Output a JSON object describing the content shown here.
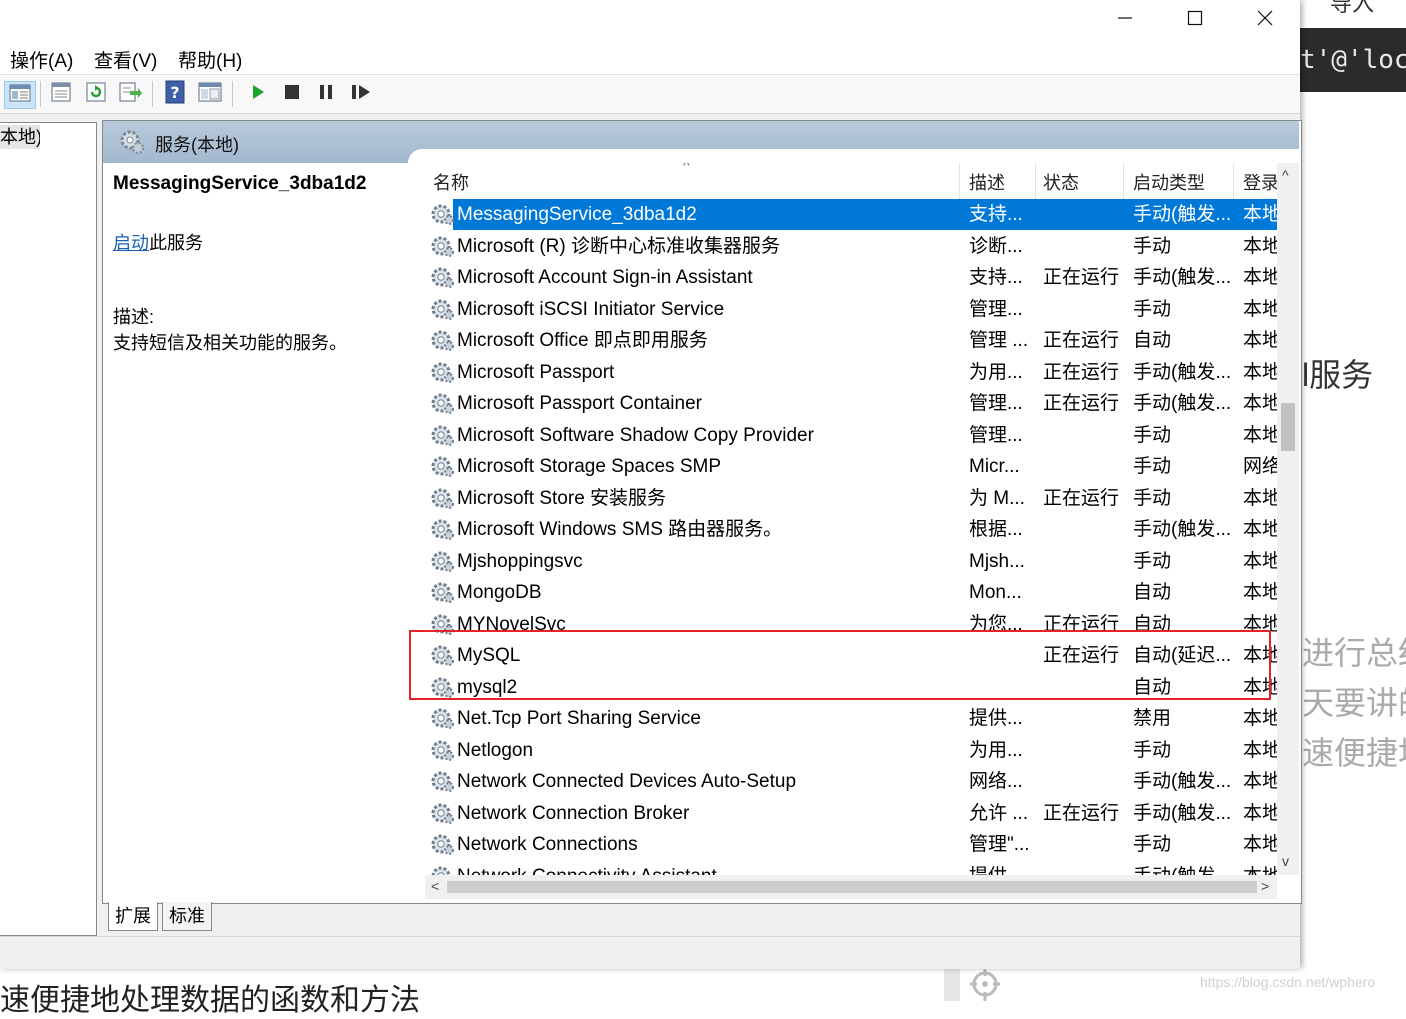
{
  "window": {
    "controls": {
      "minimize_icon": "minimize-icon",
      "maximize_icon": "maximize-icon",
      "close_icon": "close-icon"
    }
  },
  "menu": {
    "items": [
      "操作(A)",
      "查看(V)",
      "帮助(H)"
    ]
  },
  "toolbar": {
    "icons": [
      "show-hide-tree-icon",
      "properties-icon",
      "refresh-icon",
      "export-list-icon",
      "help-icon",
      "mmc-view-icon",
      "start-icon",
      "stop-icon",
      "pause-icon",
      "resume-icon"
    ]
  },
  "tree": {
    "selected_item": "本地)"
  },
  "pane_header": {
    "title": "服务(本地)"
  },
  "extended": {
    "service_name": "MessagingService_3dba1d2",
    "start_link": "启动",
    "start_suffix": "此服务",
    "desc_label": "描述:",
    "desc_text": "支持短信及相关功能的服务。"
  },
  "columns": {
    "name": "名称",
    "desc": "描述",
    "status": "状态",
    "startup": "启动类型",
    "logon": "登录"
  },
  "rows": [
    {
      "name": "MessagingService_3dba1d2",
      "desc": "支持...",
      "status": "",
      "startup": "手动(触发...",
      "logon": "本地"
    },
    {
      "name": "Microsoft (R) 诊断中心标准收集器服务",
      "desc": "诊断...",
      "status": "",
      "startup": "手动",
      "logon": "本地"
    },
    {
      "name": "Microsoft Account Sign-in Assistant",
      "desc": "支持...",
      "status": "正在运行",
      "startup": "手动(触发...",
      "logon": "本地"
    },
    {
      "name": "Microsoft iSCSI Initiator Service",
      "desc": "管理...",
      "status": "",
      "startup": "手动",
      "logon": "本地"
    },
    {
      "name": "Microsoft Office 即点即用服务",
      "desc": "管理 ...",
      "status": "正在运行",
      "startup": "自动",
      "logon": "本地"
    },
    {
      "name": "Microsoft Passport",
      "desc": "为用...",
      "status": "正在运行",
      "startup": "手动(触发...",
      "logon": "本地"
    },
    {
      "name": "Microsoft Passport Container",
      "desc": "管理...",
      "status": "正在运行",
      "startup": "手动(触发...",
      "logon": "本地"
    },
    {
      "name": "Microsoft Software Shadow Copy Provider",
      "desc": "管理...",
      "status": "",
      "startup": "手动",
      "logon": "本地"
    },
    {
      "name": "Microsoft Storage Spaces SMP",
      "desc": "Micr...",
      "status": "",
      "startup": "手动",
      "logon": "网络"
    },
    {
      "name": "Microsoft Store 安装服务",
      "desc": "为 M...",
      "status": "正在运行",
      "startup": "手动",
      "logon": "本地"
    },
    {
      "name": "Microsoft Windows SMS 路由器服务。",
      "desc": "根据...",
      "status": "",
      "startup": "手动(触发...",
      "logon": "本地"
    },
    {
      "name": "Mjshoppingsvc",
      "desc": "Mjsh...",
      "status": "",
      "startup": "手动",
      "logon": "本地"
    },
    {
      "name": "MongoDB",
      "desc": "Mon...",
      "status": "",
      "startup": "自动",
      "logon": "本地"
    },
    {
      "name": "MYNovelSvc",
      "desc": "为您...",
      "status": "正在运行",
      "startup": "自动",
      "logon": "本地"
    },
    {
      "name": "MySQL",
      "desc": "",
      "status": "正在运行",
      "startup": "自动(延迟...",
      "logon": "本地"
    },
    {
      "name": "mysql2",
      "desc": "",
      "status": "",
      "startup": "自动",
      "logon": "本地"
    },
    {
      "name": "Net.Tcp Port Sharing Service",
      "desc": "提供...",
      "status": "",
      "startup": "禁用",
      "logon": "本地"
    },
    {
      "name": "Netlogon",
      "desc": "为用...",
      "status": "",
      "startup": "手动",
      "logon": "本地"
    },
    {
      "name": "Network Connected Devices Auto-Setup",
      "desc": "网络...",
      "status": "",
      "startup": "手动(触发...",
      "logon": "本地"
    },
    {
      "name": "Network Connection Broker",
      "desc": "允许 ...",
      "status": "正在运行",
      "startup": "手动(触发...",
      "logon": "本地"
    },
    {
      "name": "Network Connections",
      "desc": "管理\"...",
      "status": "",
      "startup": "手动",
      "logon": "本地"
    },
    {
      "name": "Network Connectivity Assistant",
      "desc": "提供...",
      "status": "",
      "startup": "手动(触发...",
      "logon": "本地"
    }
  ],
  "tabs": [
    "扩展",
    "标准"
  ],
  "annotation": {
    "highlight_color": "#e3242b"
  },
  "background": {
    "top_text": "导入",
    "code_text": "t'@'loca",
    "frag_1": "l服务",
    "frag_2": "进行总结",
    "frag_3": "天要讲的",
    "frag_4": "速便捷地",
    "bottom_text": "速便捷地处理数据的函数和方法",
    "watermark": "https://blog.csdn.net/wphero"
  },
  "colors": {
    "selection": "#0078d7",
    "link": "#1a5fb4",
    "pane_header": "#a3b9cf"
  }
}
